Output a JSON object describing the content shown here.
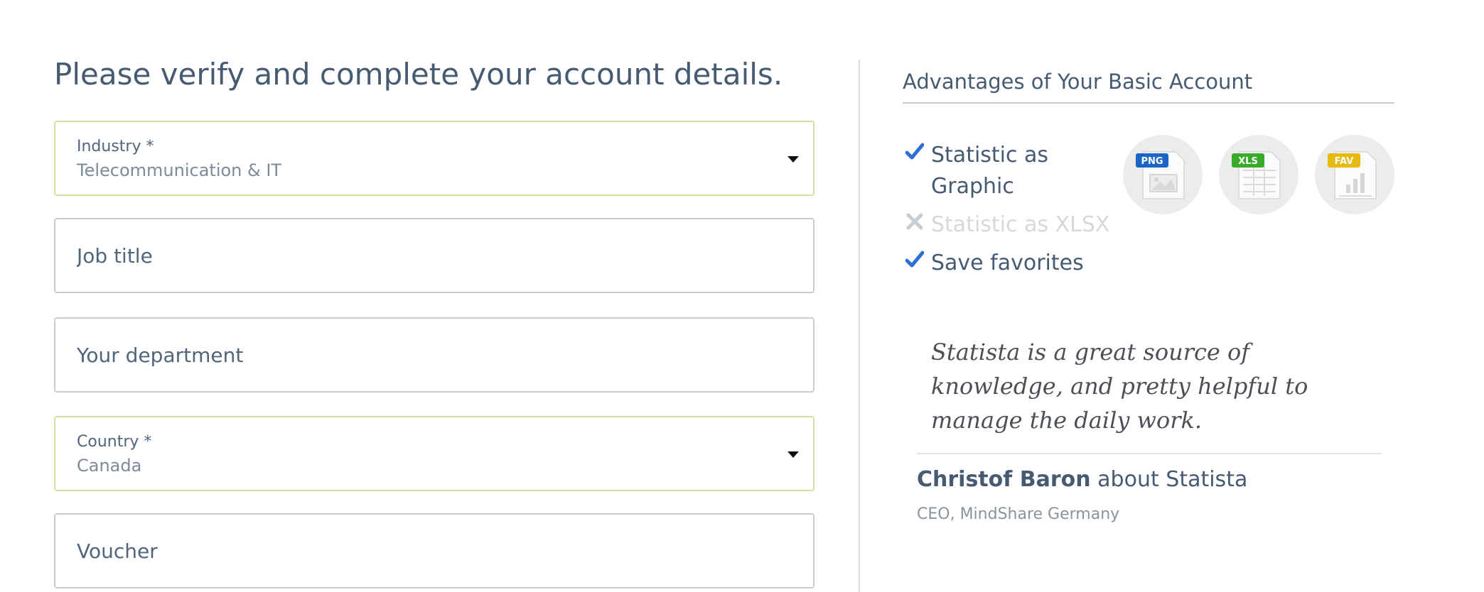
{
  "form": {
    "title": "Please verify and complete your account details.",
    "industry": {
      "label": "Industry *",
      "value": "Telecommunication & IT"
    },
    "job_title": {
      "placeholder": "Job title",
      "value": ""
    },
    "department": {
      "placeholder": "Your department",
      "value": ""
    },
    "country": {
      "label": "Country *",
      "value": "Canada"
    },
    "voucher": {
      "placeholder": "Voucher",
      "value": ""
    }
  },
  "advantages": {
    "heading": "Advantages of Your Basic Account",
    "features": [
      {
        "label": "Statistic as Graphic",
        "line1": "Statistic as",
        "line2": "Graphic",
        "included": true
      },
      {
        "label": "Statistic as XLSX",
        "included": false
      },
      {
        "label": "Save favorites",
        "included": true
      }
    ],
    "format_icons": [
      {
        "badge": "PNG",
        "icon": "png-file-icon",
        "color": "#1b64c8"
      },
      {
        "badge": "XLS",
        "icon": "xls-file-icon",
        "color": "#3aaa2a"
      },
      {
        "badge": "FAV",
        "icon": "fav-file-icon",
        "color": "#e5b90e"
      }
    ]
  },
  "testimonial": {
    "quote": "Statista is a great source of knowledge, and pretty helpful to manage the daily work.",
    "quote_lines": [
      "Statista is a great source of",
      "knowledge, and pretty helpful to",
      "manage the daily work."
    ],
    "author_name": "Christof Baron",
    "author_suffix": " about Statista",
    "author_role": "CEO, MindShare Germany"
  },
  "colors": {
    "text": "#465a72",
    "valid_border": "#d2e0a2",
    "field_border": "#c9ccd1",
    "check_blue": "#2e6fd6",
    "disabled_gray": "#d6d9dc"
  }
}
